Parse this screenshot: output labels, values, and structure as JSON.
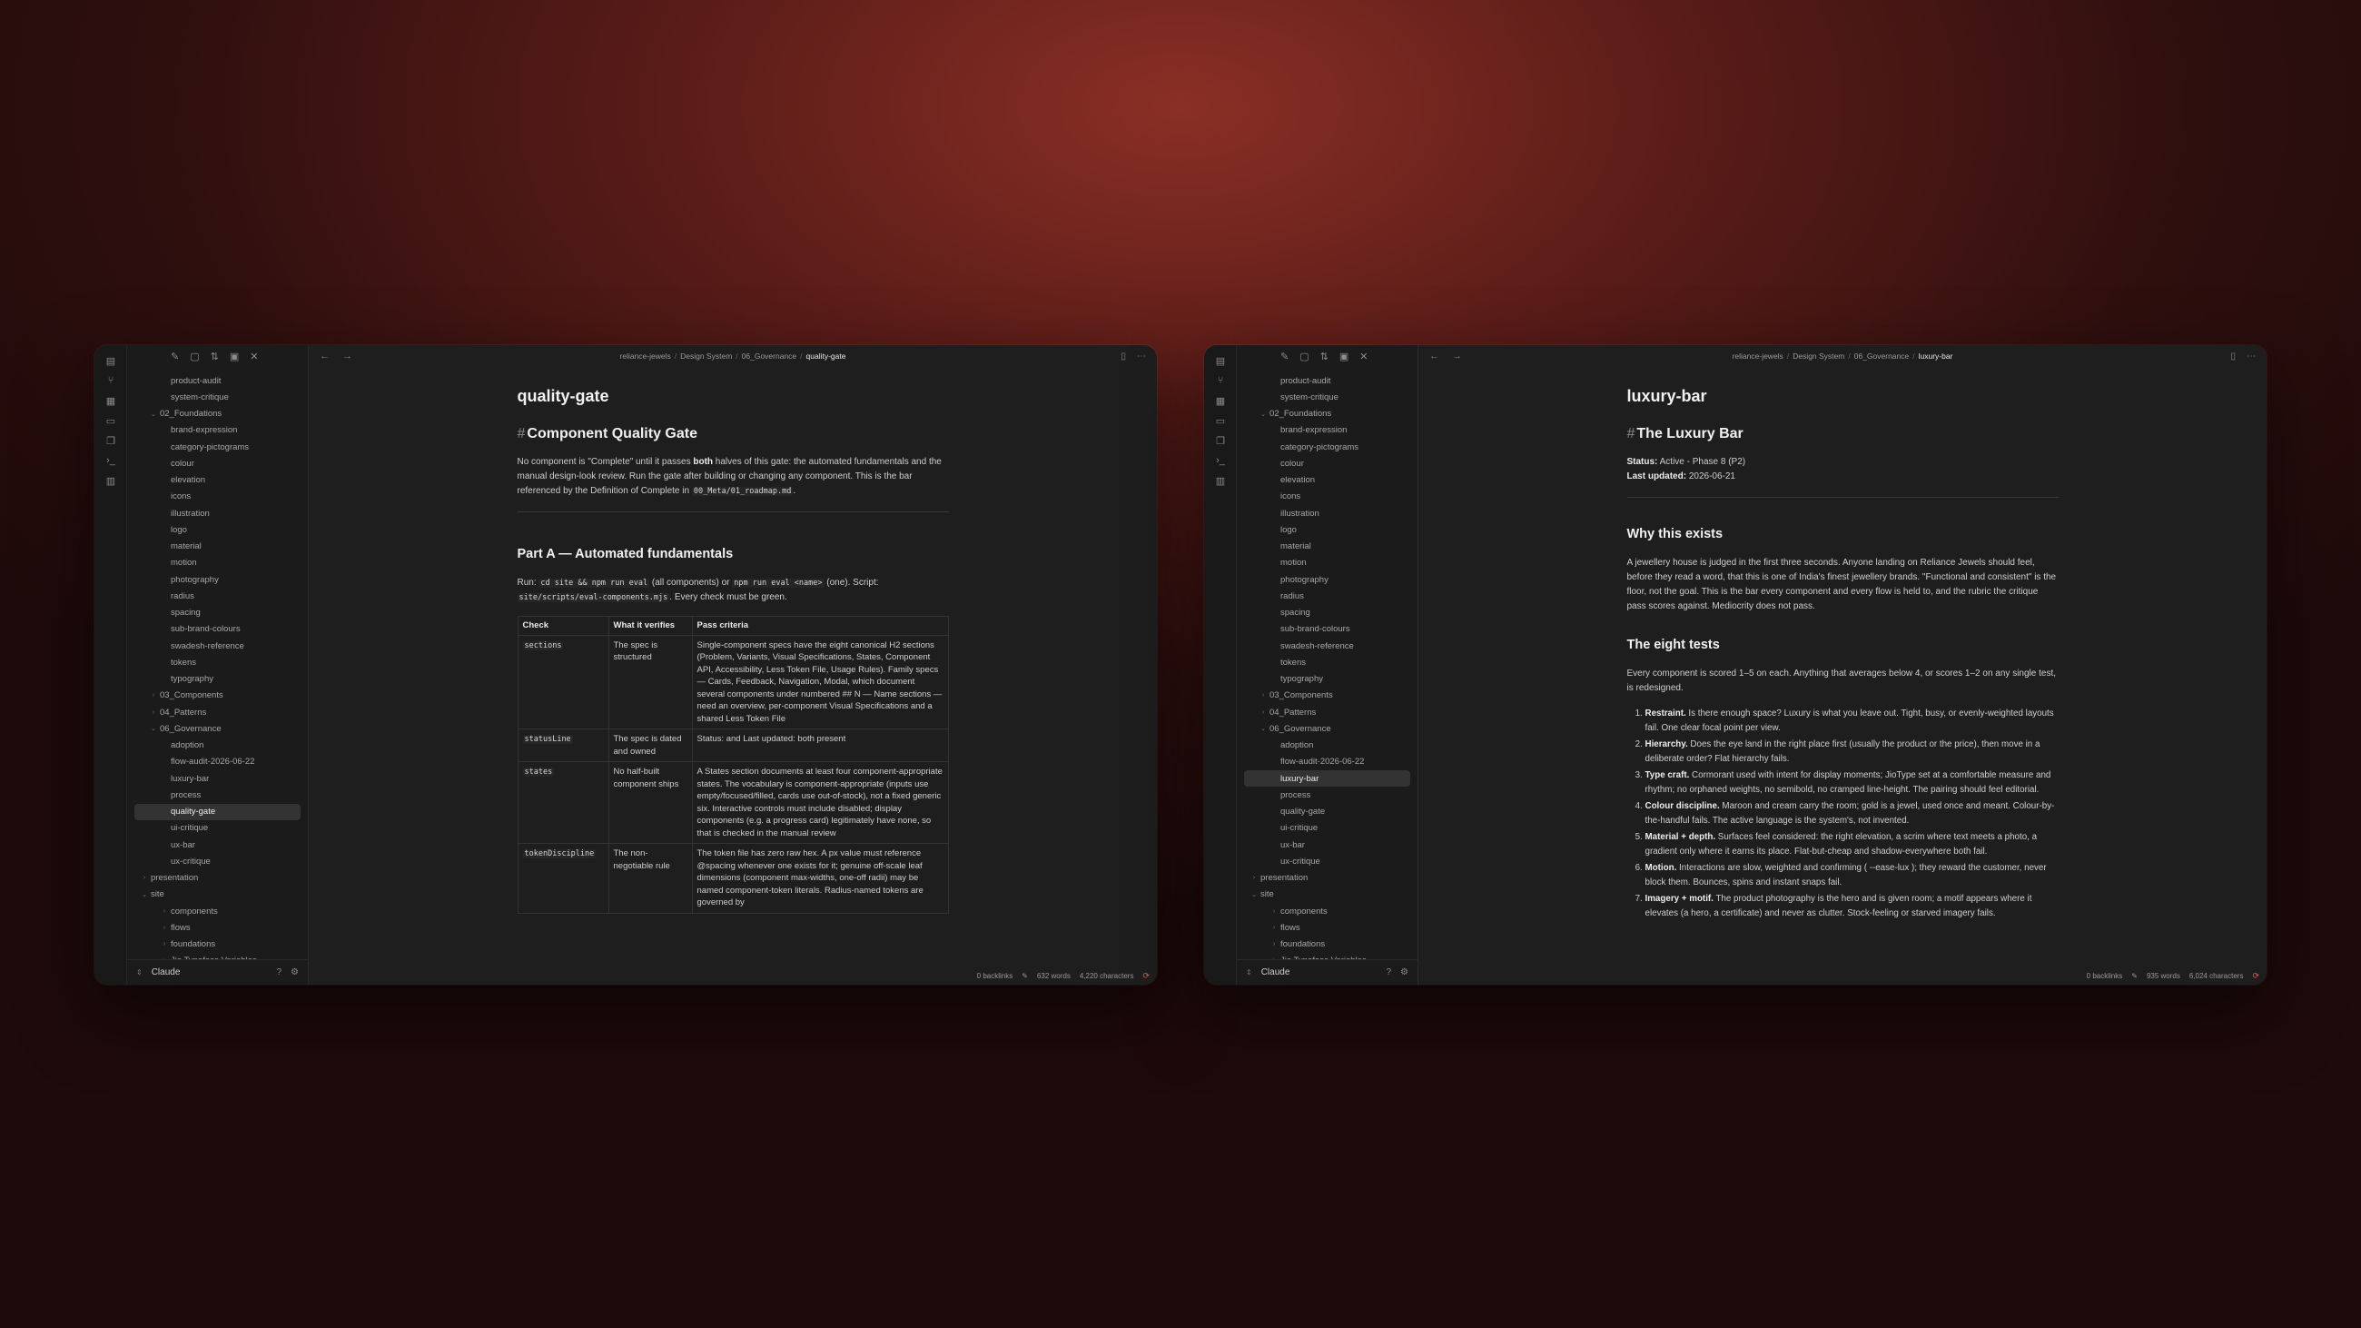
{
  "ribbon_icons": [
    "file-icon",
    "git-branch-icon",
    "grid-icon",
    "calendar-icon",
    "copy-icon",
    "terminal-icon",
    "layout-icon"
  ],
  "windows": [
    {
      "breadcrumbs": [
        "reliance-jewels",
        "Design System",
        "06_Governance",
        "quality-gate"
      ],
      "tree": [
        {
          "label": "product-audit",
          "level": 2
        },
        {
          "label": "system-critique",
          "level": 2
        },
        {
          "label": "02_Foundations",
          "level": 1,
          "folder": true,
          "open": true
        },
        {
          "label": "brand-expression",
          "level": 2
        },
        {
          "label": "category-pictograms",
          "level": 2
        },
        {
          "label": "colour",
          "level": 2
        },
        {
          "label": "elevation",
          "level": 2
        },
        {
          "label": "icons",
          "level": 2
        },
        {
          "label": "illustration",
          "level": 2
        },
        {
          "label": "logo",
          "level": 2
        },
        {
          "label": "material",
          "level": 2
        },
        {
          "label": "motion",
          "level": 2
        },
        {
          "label": "photography",
          "level": 2
        },
        {
          "label": "radius",
          "level": 2
        },
        {
          "label": "spacing",
          "level": 2
        },
        {
          "label": "sub-brand-colours",
          "level": 2
        },
        {
          "label": "swadesh-reference",
          "level": 2
        },
        {
          "label": "tokens",
          "level": 2
        },
        {
          "label": "typography",
          "level": 2
        },
        {
          "label": "03_Components",
          "level": 1,
          "folder": true,
          "open": false
        },
        {
          "label": "04_Patterns",
          "level": 1,
          "folder": true,
          "open": false
        },
        {
          "label": "06_Governance",
          "level": 1,
          "folder": true,
          "open": true
        },
        {
          "label": "adoption",
          "level": 2
        },
        {
          "label": "flow-audit-2026-06-22",
          "level": 2
        },
        {
          "label": "luxury-bar",
          "level": 2
        },
        {
          "label": "process",
          "level": 2
        },
        {
          "label": "quality-gate",
          "level": 2,
          "active": true
        },
        {
          "label": "ui-critique",
          "level": 2
        },
        {
          "label": "ux-bar",
          "level": 2
        },
        {
          "label": "ux-critique",
          "level": 2
        },
        {
          "label": "presentation",
          "level": 0,
          "folder": true,
          "open": false
        },
        {
          "label": "site",
          "level": 0,
          "folder": true,
          "open": true
        },
        {
          "label": "components",
          "level": 1,
          "folder": true,
          "open": false
        },
        {
          "label": "flows",
          "level": 1,
          "folder": true,
          "open": false
        },
        {
          "label": "foundations",
          "level": 1,
          "folder": true,
          "open": false
        },
        {
          "label": "Jio Typeface Variables",
          "level": 1,
          "folder": true,
          "open": false
        }
      ],
      "vault_name": "Claude",
      "status": {
        "backlinks": "0 backlinks",
        "words": "632 words",
        "chars": "4,220 characters"
      },
      "doc": {
        "file_title": "quality-gate",
        "h1": "Component Quality Gate",
        "intro_1": "No component is \"Complete\" until it passes ",
        "intro_bold": "both",
        "intro_2": " halves of this gate: the automated fundamentals and the manual design-look review. Run the gate after building or changing any component. This is the bar referenced by the Definition of Complete in ",
        "intro_code": "00_Meta/01_roadmap.md",
        "intro_3": ".",
        "h2": "Part A — Automated fundamentals",
        "run_1": "Run: ",
        "run_code1": "cd site && npm run eval",
        "run_2": " (all components) or ",
        "run_code2": "npm run eval <name>",
        "run_3": " (one). Script: ",
        "run_code3": "site/scripts/eval-components.mjs",
        "run_4": ". Every check must be green.",
        "table_headers": [
          "Check",
          "What it verifies",
          "Pass criteria"
        ],
        "rows": [
          {
            "check": "sections",
            "verifies": "The spec is structured",
            "pass": "Single-component specs have the eight canonical H2 sections (Problem, Variants, Visual Specifications, States, Component API, Accessibility, Less Token File, Usage Rules). Family specs — Cards, Feedback, Navigation, Modal, which document several components under numbered ## N — Name sections — need an overview, per-component Visual Specifications and a shared Less Token File"
          },
          {
            "check": "statusLine",
            "verifies": "The spec is dated and owned",
            "pass": "Status: and Last updated: both present"
          },
          {
            "check": "states",
            "verifies": "No half-built component ships",
            "pass": "A States section documents at least four component-appropriate states. The vocabulary is component-appropriate (inputs use empty/focused/filled, cards use out-of-stock), not a fixed generic six. Interactive controls must include disabled; display components (e.g. a progress card) legitimately have none, so that is checked in the manual review"
          },
          {
            "check": "tokenDiscipline",
            "verifies": "The non-negotiable rule",
            "pass": "The token file has zero raw hex. A px value must reference @spacing whenever one exists for it; genuine off-scale leaf dimensions (component max-widths, one-off radii) may be named component-token literals. Radius-named tokens are governed by"
          }
        ]
      }
    },
    {
      "breadcrumbs": [
        "reliance-jewels",
        "Design System",
        "06_Governance",
        "luxury-bar"
      ],
      "tree": [
        {
          "label": "product-audit",
          "level": 2
        },
        {
          "label": "system-critique",
          "level": 2
        },
        {
          "label": "02_Foundations",
          "level": 1,
          "folder": true,
          "open": true
        },
        {
          "label": "brand-expression",
          "level": 2
        },
        {
          "label": "category-pictograms",
          "level": 2
        },
        {
          "label": "colour",
          "level": 2
        },
        {
          "label": "elevation",
          "level": 2
        },
        {
          "label": "icons",
          "level": 2
        },
        {
          "label": "illustration",
          "level": 2
        },
        {
          "label": "logo",
          "level": 2
        },
        {
          "label": "material",
          "level": 2
        },
        {
          "label": "motion",
          "level": 2
        },
        {
          "label": "photography",
          "level": 2
        },
        {
          "label": "radius",
          "level": 2
        },
        {
          "label": "spacing",
          "level": 2
        },
        {
          "label": "sub-brand-colours",
          "level": 2
        },
        {
          "label": "swadesh-reference",
          "level": 2
        },
        {
          "label": "tokens",
          "level": 2
        },
        {
          "label": "typography",
          "level": 2
        },
        {
          "label": "03_Components",
          "level": 1,
          "folder": true,
          "open": false
        },
        {
          "label": "04_Patterns",
          "level": 1,
          "folder": true,
          "open": false
        },
        {
          "label": "06_Governance",
          "level": 1,
          "folder": true,
          "open": true
        },
        {
          "label": "adoption",
          "level": 2
        },
        {
          "label": "flow-audit-2026-06-22",
          "level": 2
        },
        {
          "label": "luxury-bar",
          "level": 2,
          "active": true
        },
        {
          "label": "process",
          "level": 2
        },
        {
          "label": "quality-gate",
          "level": 2
        },
        {
          "label": "ui-critique",
          "level": 2
        },
        {
          "label": "ux-bar",
          "level": 2
        },
        {
          "label": "ux-critique",
          "level": 2
        },
        {
          "label": "presentation",
          "level": 0,
          "folder": true,
          "open": false
        },
        {
          "label": "site",
          "level": 0,
          "folder": true,
          "open": true
        },
        {
          "label": "components",
          "level": 1,
          "folder": true,
          "open": false
        },
        {
          "label": "flows",
          "level": 1,
          "folder": true,
          "open": false
        },
        {
          "label": "foundations",
          "level": 1,
          "folder": true,
          "open": false
        },
        {
          "label": "Jio Typeface Variables",
          "level": 1,
          "folder": true,
          "open": false
        }
      ],
      "vault_name": "Claude",
      "status": {
        "backlinks": "0 backlinks",
        "words": "935 words",
        "chars": "6,024 characters"
      },
      "doc": {
        "file_title": "luxury-bar",
        "h1": "The Luxury Bar",
        "status_label": "Status:",
        "status_value": " Active - Phase 8 (P2)",
        "updated_label": "Last updated:",
        "updated_value": " 2026-06-21",
        "h2_why": "Why this exists",
        "why_text": "A jewellery house is judged in the first three seconds. Anyone landing on Reliance Jewels should feel, before they read a word, that this is one of India's finest jewellery brands. \"Functional and consistent\" is the floor, not the goal. This is the bar every component and every flow is held to, and the rubric the critique pass scores against. Mediocrity does not pass.",
        "h2_tests": "The eight tests",
        "tests_intro": "Every component is scored 1–5 on each. Anything that averages below 4, or scores 1–2 on any single test, is redesigned.",
        "tests": [
          {
            "name": "Restraint.",
            "text": " Is there enough space? Luxury is what you leave out. Tight, busy, or evenly-weighted layouts fail. One clear focal point per view."
          },
          {
            "name": "Hierarchy.",
            "text": " Does the eye land in the right place first (usually the product or the price), then move in a deliberate order? Flat hierarchy fails."
          },
          {
            "name": "Type craft.",
            "text": " Cormorant used with intent for display moments; JioType set at a comfortable measure and rhythm; no orphaned weights, no semibold, no cramped line-height. The pairing should feel editorial."
          },
          {
            "name": "Colour discipline.",
            "text": " Maroon and cream carry the room; gold is a jewel, used once and meant. Colour-by-the-handful fails. The active language is the system's, not invented."
          },
          {
            "name": "Material + depth.",
            "text": " Surfaces feel considered: the right elevation, a scrim where text meets a photo, a gradient only where it earns its place. Flat-but-cheap and shadow-everywhere both fail."
          },
          {
            "name": "Motion.",
            "text": " Interactions are slow, weighted and confirming ( --ease-lux ); they reward the customer, never block them. Bounces, spins and instant snaps fail."
          },
          {
            "name": "Imagery + motif.",
            "text": " The product photography is the hero and is given room; a motif appears where it elevates (a hero, a certificate) and never as clutter. Stock-feeling or starved imagery fails."
          }
        ]
      }
    }
  ],
  "colors": {
    "accent_sync": "#e25a5a",
    "active_bg": "#333333",
    "window_bg": "#1e1e1e"
  }
}
